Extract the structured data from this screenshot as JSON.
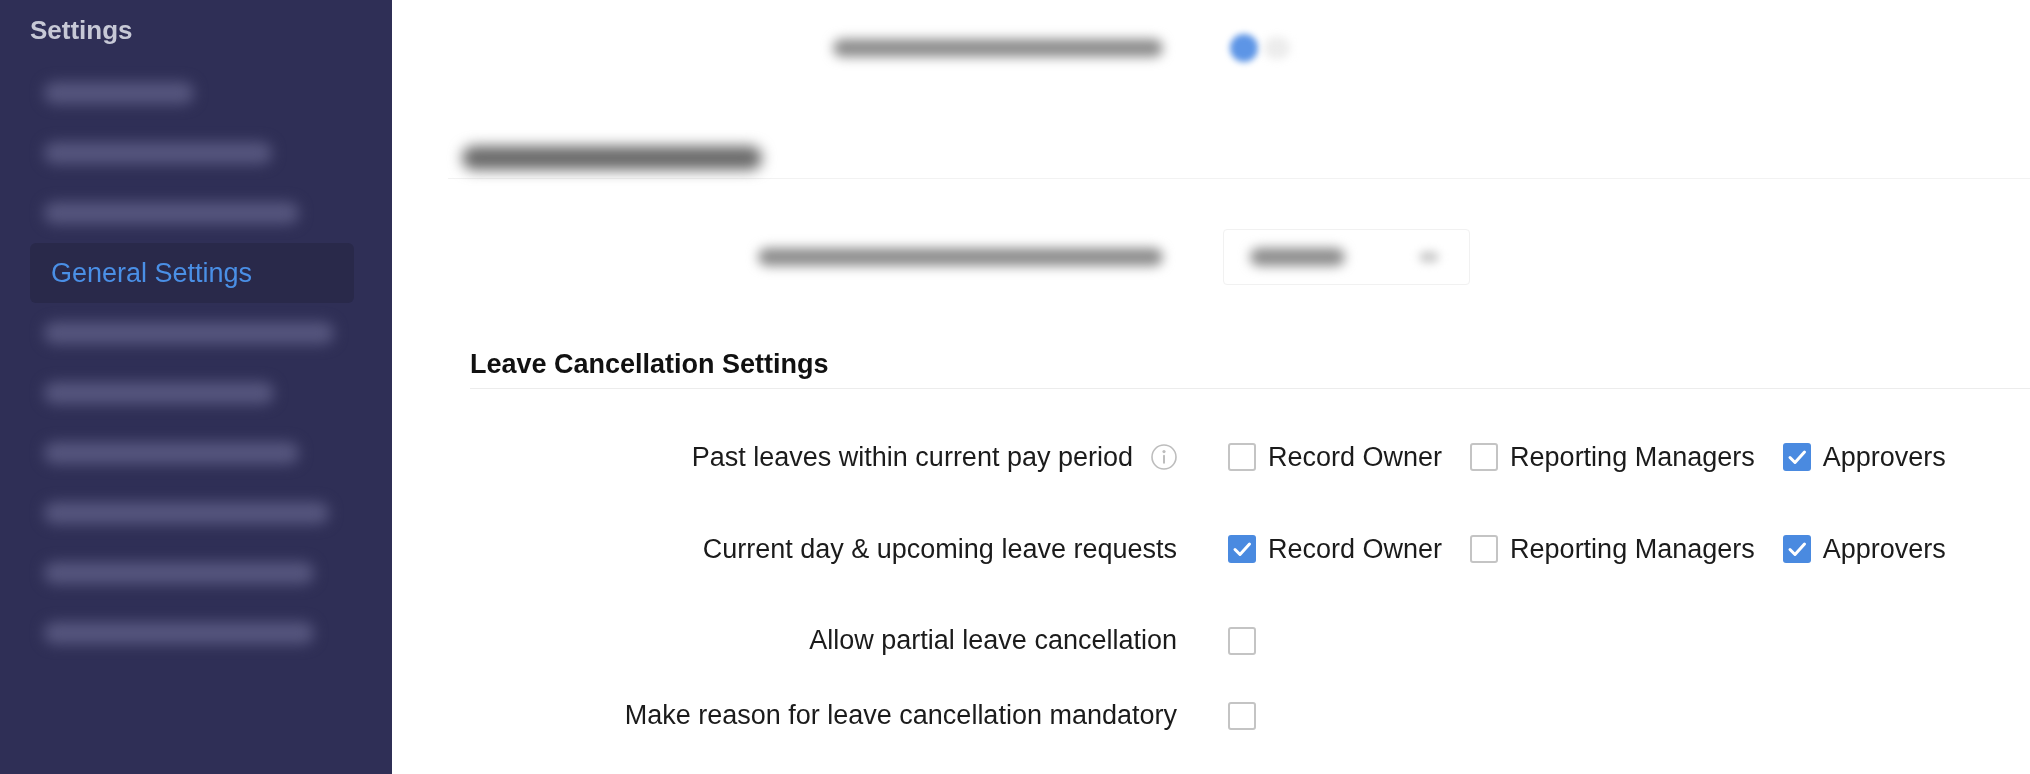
{
  "sidebar": {
    "title": "Settings",
    "items": [
      {
        "kind": "blurred",
        "selected": false
      },
      {
        "kind": "blurred",
        "selected": false
      },
      {
        "kind": "blurred",
        "selected": false
      },
      {
        "kind": "link",
        "label": "General Settings",
        "selected": true
      },
      {
        "kind": "blurred",
        "selected": false
      },
      {
        "kind": "blurred",
        "selected": false
      },
      {
        "kind": "blurred",
        "selected": false
      },
      {
        "kind": "blurred",
        "selected": false
      },
      {
        "kind": "blurred",
        "selected": false
      },
      {
        "kind": "blurred",
        "selected": false
      }
    ]
  },
  "obscured_content": [
    {
      "kind": "toggle_row",
      "on": true
    },
    {
      "kind": "heading"
    },
    {
      "kind": "dropdown_row"
    }
  ],
  "leave_cancellation": {
    "title": "Leave Cancellation Settings",
    "rows": [
      {
        "kind": "options",
        "label": "Past leaves within current pay period",
        "info": true,
        "options": [
          {
            "label": "Record Owner",
            "checked": false
          },
          {
            "label": "Reporting Managers",
            "checked": false
          },
          {
            "label": "Approvers",
            "checked": true
          }
        ]
      },
      {
        "kind": "options",
        "label": "Current day & upcoming leave requests",
        "info": false,
        "options": [
          {
            "label": "Record Owner",
            "checked": true
          },
          {
            "label": "Reporting Managers",
            "checked": false
          },
          {
            "label": "Approvers",
            "checked": true
          }
        ]
      },
      {
        "kind": "checkbox",
        "label": "Allow partial leave cancellation",
        "info": false,
        "checked": false
      },
      {
        "kind": "checkbox",
        "label": "Make reason for leave cancellation mandatory",
        "info": false,
        "checked": false
      }
    ]
  }
}
